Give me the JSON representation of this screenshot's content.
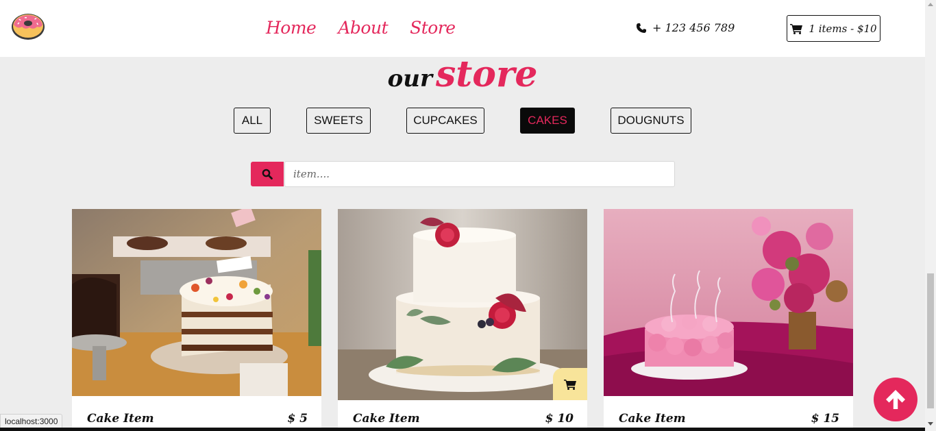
{
  "nav": {
    "links": [
      "Home",
      "About",
      "Store"
    ],
    "phone": "+ 123 456 789",
    "cart": "1 items - $10"
  },
  "title": {
    "our": "our",
    "store": "store"
  },
  "filters": [
    {
      "label": "ALL",
      "active": false
    },
    {
      "label": "SWEETS",
      "active": false
    },
    {
      "label": "CUPCAKES",
      "active": false
    },
    {
      "label": "CAKES",
      "active": true
    },
    {
      "label": "DOUGNUTS",
      "active": false
    }
  ],
  "search": {
    "placeholder": "item...."
  },
  "products": [
    {
      "name": "Cake Item",
      "price": "$ 5"
    },
    {
      "name": "Cake Item",
      "price": "$ 10"
    },
    {
      "name": "Cake Item",
      "price": "$ 15"
    }
  ],
  "status_url": "localhost:3000",
  "colors": {
    "accent": "#e4285c",
    "cart_tab": "#f8e49a",
    "background": "#ededed"
  },
  "icons": [
    "donut-logo-icon",
    "phone-icon",
    "cart-icon",
    "search-icon",
    "arrow-up-icon"
  ]
}
